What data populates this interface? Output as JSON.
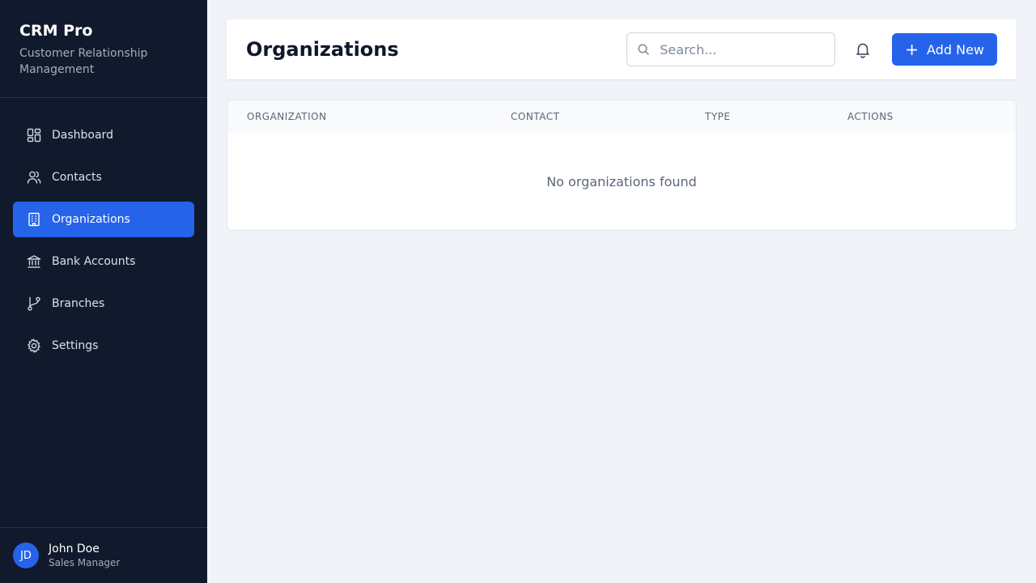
{
  "sidebar": {
    "title": "CRM Pro",
    "subtitle": "Customer Relationship Management",
    "items": [
      {
        "label": "Dashboard",
        "icon": "dashboard-icon",
        "active": false
      },
      {
        "label": "Contacts",
        "icon": "users-icon",
        "active": false
      },
      {
        "label": "Organizations",
        "icon": "building-icon",
        "active": true
      },
      {
        "label": "Bank Accounts",
        "icon": "bank-icon",
        "active": false
      },
      {
        "label": "Branches",
        "icon": "git-branch-icon",
        "active": false
      },
      {
        "label": "Settings",
        "icon": "gear-icon",
        "active": false
      }
    ],
    "user": {
      "initials": "JD",
      "name": "John Doe",
      "role": "Sales Manager"
    }
  },
  "header": {
    "title": "Organizations",
    "search_placeholder": "Search...",
    "add_label": "Add New"
  },
  "table": {
    "columns": [
      "ORGANIZATION",
      "CONTACT",
      "TYPE",
      "ACTIONS"
    ],
    "empty_message": "No organizations found"
  },
  "colors": {
    "sidebar_bg": "#111a2c",
    "accent": "#2563eb",
    "page_bg": "#f0f3f8"
  }
}
